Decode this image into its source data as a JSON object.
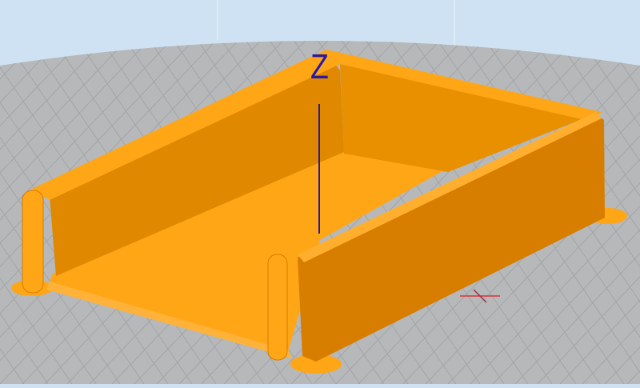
{
  "viewport": {
    "axis_labels": {
      "z": "Z"
    },
    "colors": {
      "sky": "#cfe2f3",
      "build_plate": "#b4b6b9",
      "grid": "#9ea1a4",
      "model_top": "#ffa617",
      "model_inner_wall": "#e58c00",
      "model_outer_wall": "#d87e00",
      "z_axis": "#2a1aa0",
      "x_axis": "#d8343a"
    }
  }
}
